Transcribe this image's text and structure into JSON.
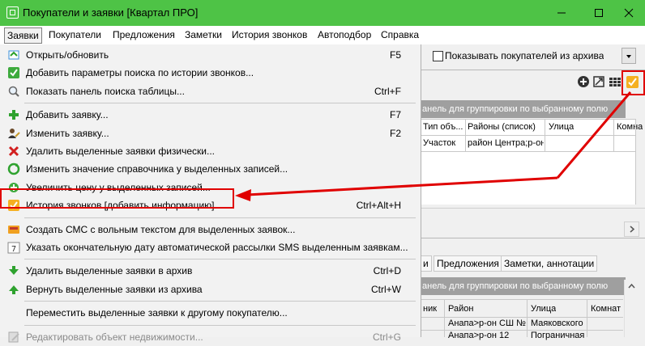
{
  "window": {
    "title": "Покупатели и заявки [Квартал ПРО]",
    "title_bar_color": "#4ec346"
  },
  "menubar": [
    "Заявки",
    "Покупатели",
    "Предложения",
    "Заметки",
    "История звонков",
    "Автоподбор",
    "Справка"
  ],
  "background": {
    "archive_checkbox_label": "Показывать покупателей из архива",
    "group_panel_top": "анель для группировки по выбранному полю",
    "group_panel_bottom": "анель для группировки по выбранному полю",
    "top_table": {
      "headers": [
        "Тип объ...",
        "Районы (список)",
        "Улица",
        "Комна"
      ],
      "row": [
        "Участок",
        "район Центра;р-он",
        "",
        ""
      ]
    },
    "tabs": [
      "и",
      "Предложения",
      "Заметки, аннотации"
    ],
    "bottom_table": {
      "headers": [
        "ник",
        "Район",
        "Улица",
        "Комнат"
      ],
      "rows": [
        [
          "",
          "Анапа>р-он СШ №",
          "Маяковского",
          ""
        ],
        [
          "",
          "Анапа>р-он 12",
          "Пограничная",
          ""
        ]
      ]
    }
  },
  "dropdown_menu": {
    "items": [
      {
        "type": "item",
        "icon": "open-refresh-icon",
        "label": "Открыть/обновить",
        "shortcut": "F5"
      },
      {
        "type": "item",
        "icon": "check-add-icon",
        "label": "Добавить параметры поиска по истории звонков...",
        "shortcut": ""
      },
      {
        "type": "item",
        "icon": "magnifier-icon",
        "label": "Показать панель поиска таблицы...",
        "shortcut": "Ctrl+F"
      },
      {
        "type": "separator"
      },
      {
        "type": "item",
        "icon": "plus-icon",
        "label": "Добавить заявку...",
        "shortcut": "F7"
      },
      {
        "type": "item",
        "icon": "edit-person-icon",
        "label": "Изменить заявку...",
        "shortcut": "F2"
      },
      {
        "type": "item",
        "icon": "delete-x-icon",
        "label": "Удалить выделенные заявки физически...",
        "shortcut": ""
      },
      {
        "type": "item",
        "icon": "refresh-green-icon",
        "label": "Изменить значение справочника у выделенных записей...",
        "shortcut": ""
      },
      {
        "type": "item",
        "icon": "plus-price-icon",
        "label": "Увеличить цену у выделенных записей...",
        "shortcut": ""
      },
      {
        "type": "item",
        "icon": "call-history-icon",
        "label": "История звонков [добавить информацию]...",
        "shortcut": "Ctrl+Alt+H",
        "highlighted": true
      },
      {
        "type": "separator"
      },
      {
        "type": "item",
        "icon": "sms-icon",
        "label": "Создать СМС с вольным текстом для выделенных заявок...",
        "shortcut": ""
      },
      {
        "type": "item",
        "icon": "calendar-7-icon",
        "label": "Указать окончательную дату автоматической рассылки SMS выделенным заявкам...",
        "shortcut": ""
      },
      {
        "type": "separator"
      },
      {
        "type": "item",
        "icon": "archive-down-icon",
        "label": "Удалить выделенные заявки в архив",
        "shortcut": "Ctrl+D"
      },
      {
        "type": "item",
        "icon": "archive-up-icon",
        "label": "Вернуть выделенные заявки из архива",
        "shortcut": "Ctrl+W"
      },
      {
        "type": "separator"
      },
      {
        "type": "item",
        "icon": "",
        "label": "Переместить выделенные заявки к другому покупателю...",
        "shortcut": ""
      },
      {
        "type": "separator"
      },
      {
        "type": "item",
        "icon": "edit-disabled-icon",
        "label": "Редактировать объект недвижимости...",
        "shortcut": "Ctrl+G",
        "disabled": true
      }
    ]
  },
  "annotation_color": "#e00000"
}
